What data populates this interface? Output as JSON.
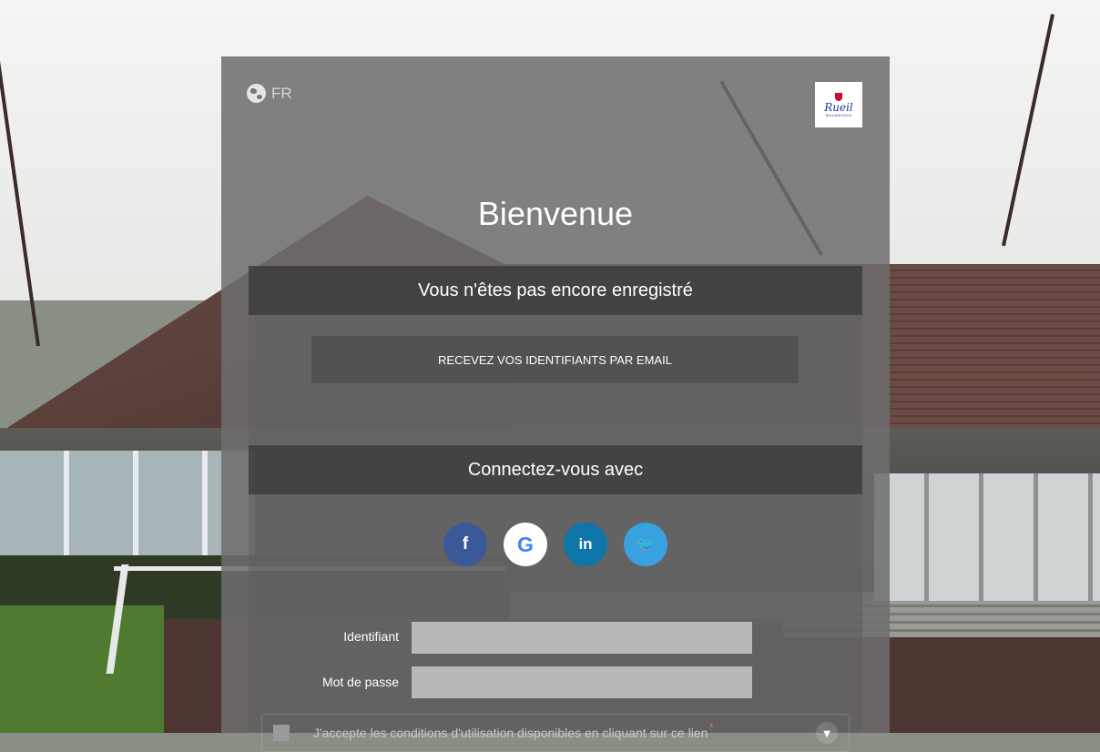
{
  "language": {
    "code": "FR",
    "icon": "globe-icon"
  },
  "logo": {
    "word": "Rueil",
    "sub": "MALMAISON"
  },
  "welcome_title": "Bienvenue",
  "register": {
    "heading": "Vous n'êtes pas encore enregistré",
    "email_button": "RECEVEZ VOS IDENTIFIANTS PAR EMAIL"
  },
  "social": {
    "heading": "Connectez-vous avec",
    "providers": [
      {
        "name": "facebook",
        "glyph": "f",
        "color": "#3b5998"
      },
      {
        "name": "google",
        "glyph": "G",
        "color": "#ffffff"
      },
      {
        "name": "linkedin",
        "glyph": "in",
        "color": "#0e76a8"
      },
      {
        "name": "twitter",
        "glyph": "🐦",
        "color": "#3aa1e0"
      }
    ]
  },
  "login": {
    "username_label": "Identifiant",
    "username_value": "",
    "password_label": "Mot de passe",
    "password_value": ""
  },
  "terms": {
    "text": "J'accepte les conditions d'utilisation disponibles en cliquant sur ce lien",
    "required_mark": "*",
    "expand_glyph": "▼"
  }
}
